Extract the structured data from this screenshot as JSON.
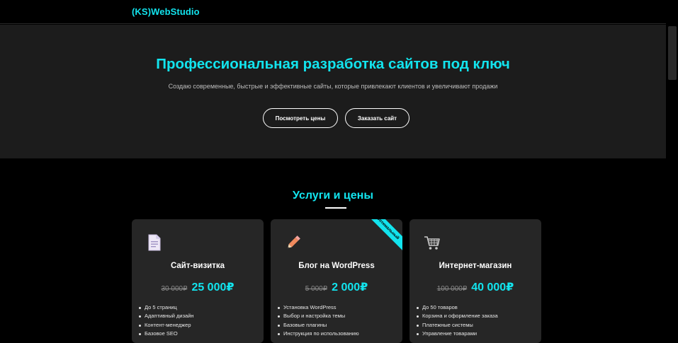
{
  "header": {
    "logo_ks": "(KS)",
    "logo_name": "WebStudio"
  },
  "hero": {
    "title": "Профессиональная разработка сайтов под ключ",
    "subtitle": "Создаю современные, быстрые и эффективные сайты, которые привлекают клиентов и увеличивают продажи",
    "btn_prices": "Посмотреть цены",
    "btn_order": "Заказать сайт"
  },
  "services": {
    "title": "Услуги и цены",
    "cards": [
      {
        "icon": "document-icon",
        "title": "Сайт-визитка",
        "old_price": "30 000₽",
        "new_price": "25 000₽",
        "features": [
          "До 5 страниц",
          "Адаптивный дизайн",
          "Контент-менеджер",
          "Базовое SEO"
        ]
      },
      {
        "icon": "pencil-icon",
        "title": "Блог на WordPress",
        "ribbon": "Оптимальный",
        "old_price": "5 000₽",
        "new_price": "2 000₽",
        "features": [
          "Установка WordPress",
          "Выбор и настройка темы",
          "Базовые плагины",
          "Инструкция по использованию"
        ]
      },
      {
        "icon": "shopping-cart-icon",
        "title": "Интернет-магазин",
        "old_price": "100 000₽",
        "new_price": "40 000₽",
        "features": [
          "До 50 товаров",
          "Корзина и оформление заказа",
          "Платежные системы",
          "Управление товарами"
        ]
      }
    ]
  },
  "colors": {
    "accent": "#12e4ee",
    "background": "#000000",
    "hero_bg": "#1c1c1c",
    "card_bg": "#262626"
  }
}
